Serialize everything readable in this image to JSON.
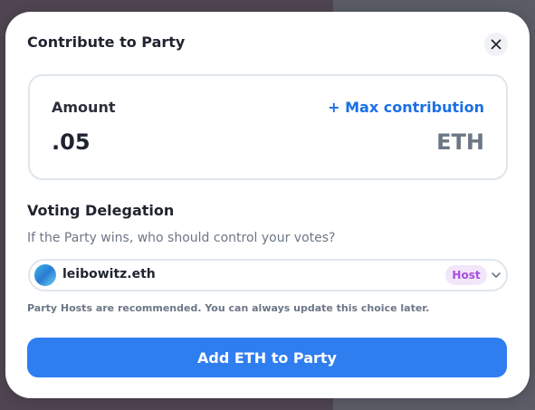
{
  "modal": {
    "title": "Contribute to Party"
  },
  "amount": {
    "label": "Amount",
    "max_link": "+ Max contribution",
    "value": ".05",
    "currency": "ETH"
  },
  "voting": {
    "title": "Voting Delegation",
    "question": "If the Party wins, who should control your votes?",
    "selected_delegate": "leibowitz.eth",
    "badge": "Host",
    "hint": "Party Hosts are recommended. You can always update this choice later."
  },
  "actions": {
    "submit_label": "Add ETH to Party"
  },
  "colors": {
    "accent": "#2f7ef0",
    "link": "#1a6fe6",
    "badge_bg": "#f2e6fb",
    "badge_text": "#a64fe0"
  }
}
